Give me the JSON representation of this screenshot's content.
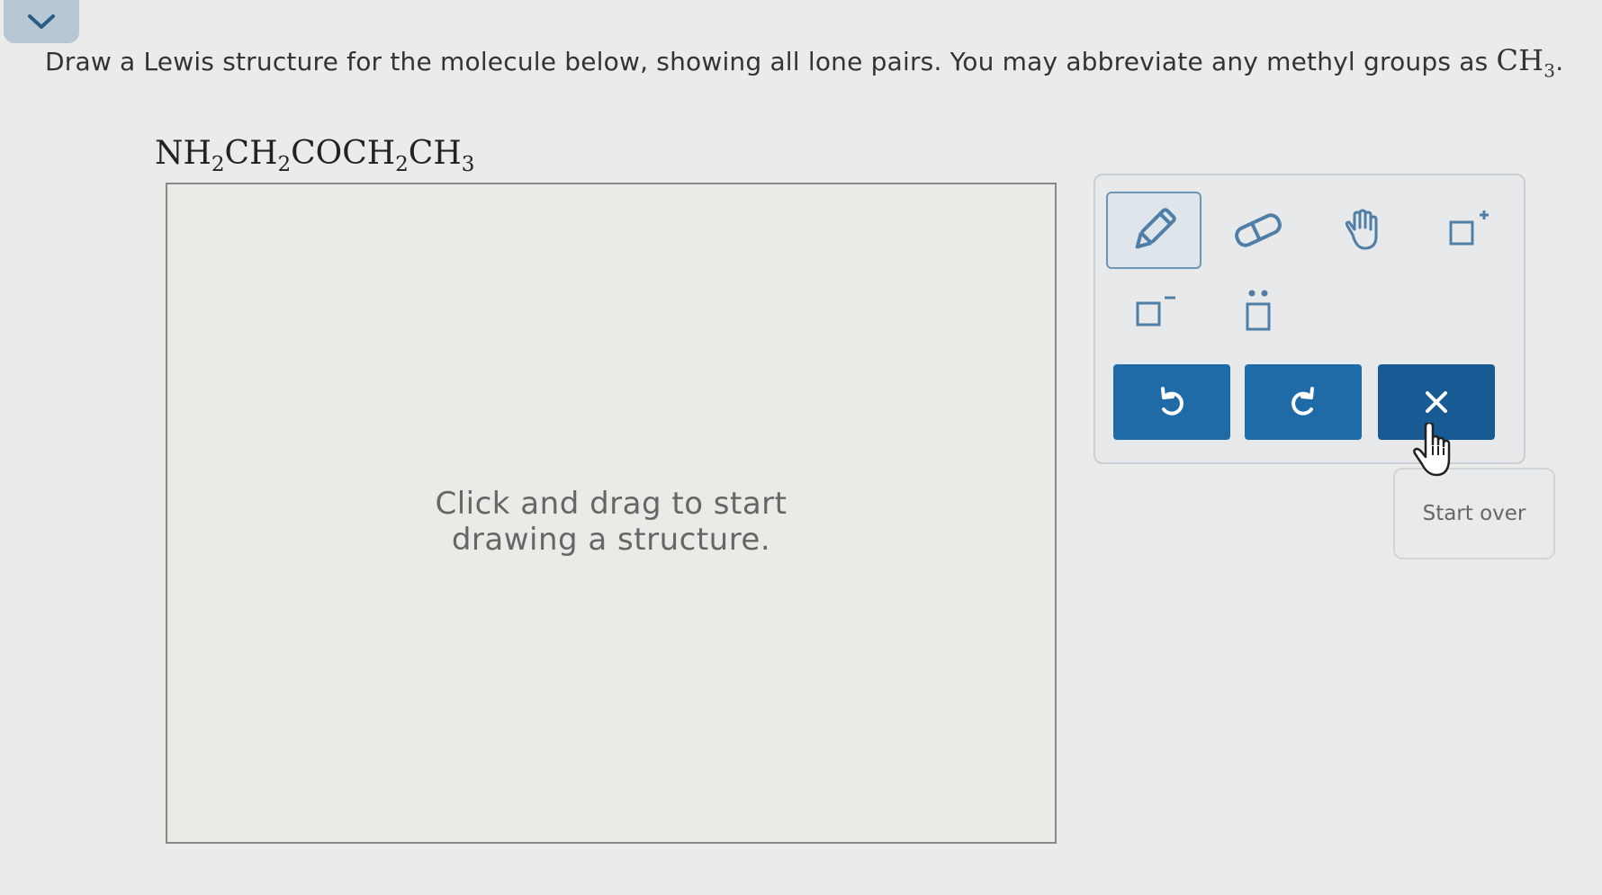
{
  "header": {
    "collapse_icon": "chevron-down-icon"
  },
  "question": {
    "text": "Draw a Lewis structure for the molecule below, showing all lone pairs. You may abbreviate any methyl groups as",
    "methyl_base": "CH",
    "methyl_sub": "3",
    "end": "."
  },
  "molecule": {
    "parts": [
      "NH",
      "2",
      "CH",
      "2",
      "COCH",
      "2",
      "CH",
      "3"
    ]
  },
  "canvas": {
    "hint_line1": "Click and drag to start",
    "hint_line2": "drawing a structure."
  },
  "toolbar": {
    "tools": [
      "pencil-icon",
      "eraser-icon",
      "hand-icon",
      "positive-charge-icon",
      "negative-charge-icon",
      "lone-pair-icon"
    ],
    "actions": [
      "undo-icon",
      "redo-icon",
      "clear-icon"
    ],
    "accent": "#1f6ba8",
    "clear_color": "#175a94"
  },
  "start_over": {
    "label": "Start over"
  }
}
